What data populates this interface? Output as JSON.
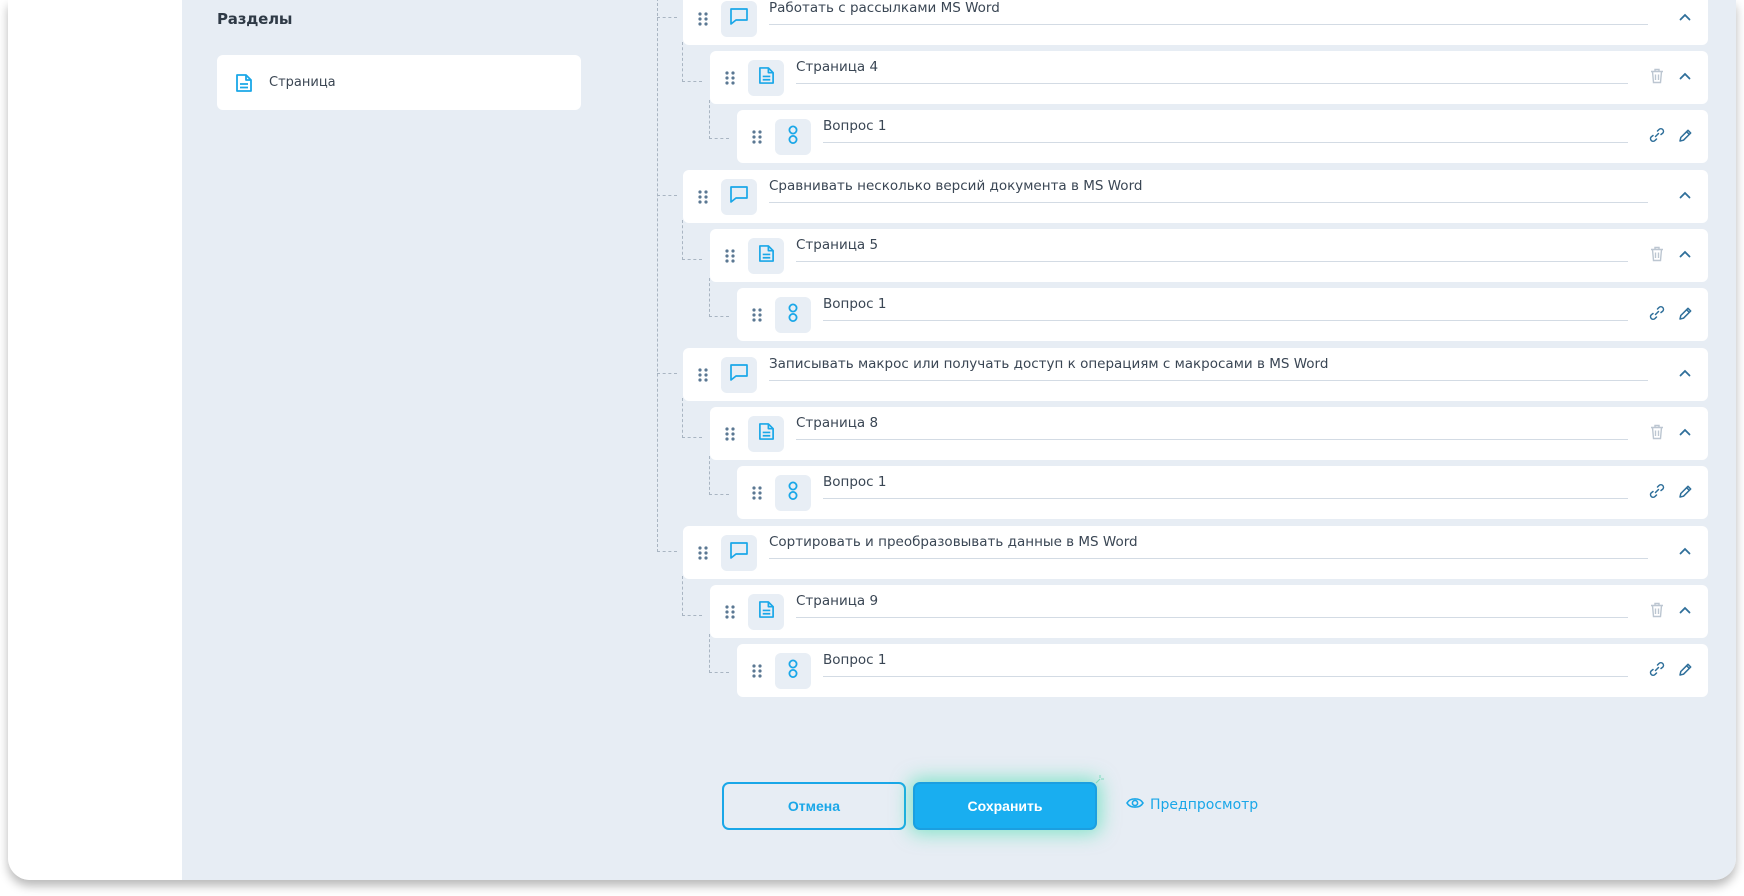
{
  "sidebar": {
    "title": "Разделы",
    "items": [
      {
        "label": "Страница"
      }
    ]
  },
  "tree": {
    "topics": [
      {
        "title": "Работать с рассылками MS Word",
        "page": {
          "title": "Страница 4"
        },
        "question": {
          "title": "Вопрос 1"
        }
      },
      {
        "title": "Сравнивать несколько версий документа в MS Word",
        "page": {
          "title": "Страница 5"
        },
        "question": {
          "title": "Вопрос 1"
        }
      },
      {
        "title": "Записывать макрос или получать доступ к операциям с макросами в MS Word",
        "page": {
          "title": "Страница 8"
        },
        "question": {
          "title": "Вопрос 1"
        }
      },
      {
        "title": "Сортировать и преобразовывать данные в MS Word",
        "page": {
          "title": "Страница 9"
        },
        "question": {
          "title": "Вопрос 1"
        }
      }
    ]
  },
  "footer": {
    "cancel_label": "Отмена",
    "save_label": "Сохранить",
    "preview_label": "Предпросмотр"
  },
  "icons": {
    "topic": "comment-icon",
    "page": "document-icon",
    "question": "question-icon",
    "drag": "drag-handle-icon",
    "delete": "trash-icon",
    "collapse": "chevron-up-icon",
    "link": "link-icon",
    "edit": "pencil-icon",
    "preview": "eye-icon"
  },
  "colors": {
    "accent": "#1aa7e8",
    "background": "#e7edf4",
    "card": "#ffffff",
    "glow": "#36dcaa"
  }
}
